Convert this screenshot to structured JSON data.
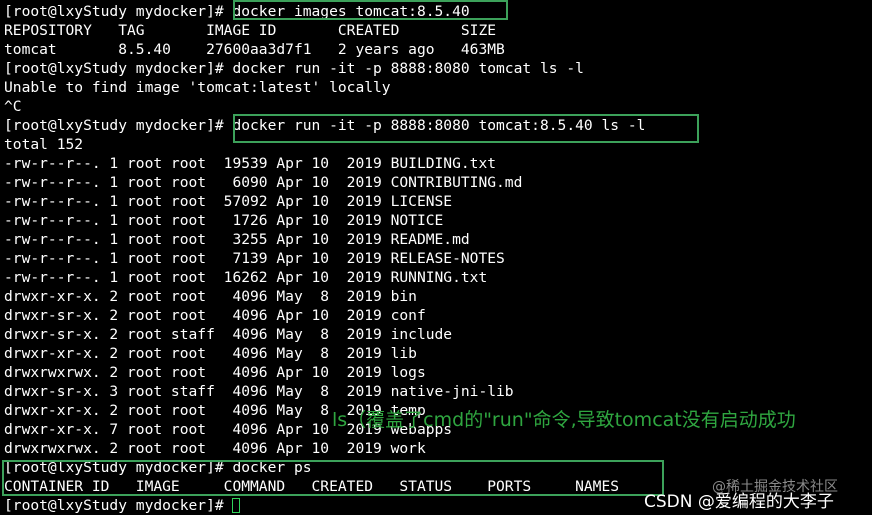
{
  "terminal": {
    "lines": [
      "[root@lxyStudy mydocker]# docker images tomcat:8.5.40",
      "REPOSITORY   TAG       IMAGE ID       CREATED       SIZE",
      "tomcat       8.5.40    27600aa3d7f1   2 years ago   463MB",
      "[root@lxyStudy mydocker]# docker run -it -p 8888:8080 tomcat ls -l",
      "Unable to find image 'tomcat:latest' locally",
      "^C",
      "[root@lxyStudy mydocker]# docker run -it -p 8888:8080 tomcat:8.5.40 ls -l",
      "total 152",
      "-rw-r--r--. 1 root root  19539 Apr 10  2019 BUILDING.txt",
      "-rw-r--r--. 1 root root   6090 Apr 10  2019 CONTRIBUTING.md",
      "-rw-r--r--. 1 root root  57092 Apr 10  2019 LICENSE",
      "-rw-r--r--. 1 root root   1726 Apr 10  2019 NOTICE",
      "-rw-r--r--. 1 root root   3255 Apr 10  2019 README.md",
      "-rw-r--r--. 1 root root   7139 Apr 10  2019 RELEASE-NOTES",
      "-rw-r--r--. 1 root root  16262 Apr 10  2019 RUNNING.txt",
      "drwxr-xr-x. 2 root root   4096 May  8  2019 bin",
      "drwxr-sr-x. 2 root root   4096 Apr 10  2019 conf",
      "drwxr-sr-x. 2 root staff  4096 May  8  2019 include",
      "drwxr-xr-x. 2 root root   4096 May  8  2019 lib",
      "drwxrwxrwx. 2 root root   4096 Apr 10  2019 logs",
      "drwxr-sr-x. 3 root staff  4096 May  8  2019 native-jni-lib",
      "drwxr-xr-x. 2 root root   4096 May  8  2019 temp",
      "drwxr-xr-x. 7 root root   4096 Apr 10  2019 webapps",
      "drwxrwxrwx. 2 root root   4096 Apr 10  2019 work",
      "[root@lxyStudy mydocker]# docker ps",
      "CONTAINER ID   IMAGE     COMMAND   CREATED   STATUS    PORTS     NAMES"
    ],
    "last_prompt": "[root@lxyStudy mydocker]# "
  },
  "annotation": "ls（覆盖了cmd的\"run\"命令,导致tomcat没有启动成功",
  "watermark": {
    "faint": "@稀土掘金技术社区",
    "main": "CSDN @爱编程的大李子"
  },
  "colors": {
    "background": "#000000",
    "text": "#ffffff",
    "highlight_box": "#3ca15a",
    "annotation": "#2fa640"
  }
}
